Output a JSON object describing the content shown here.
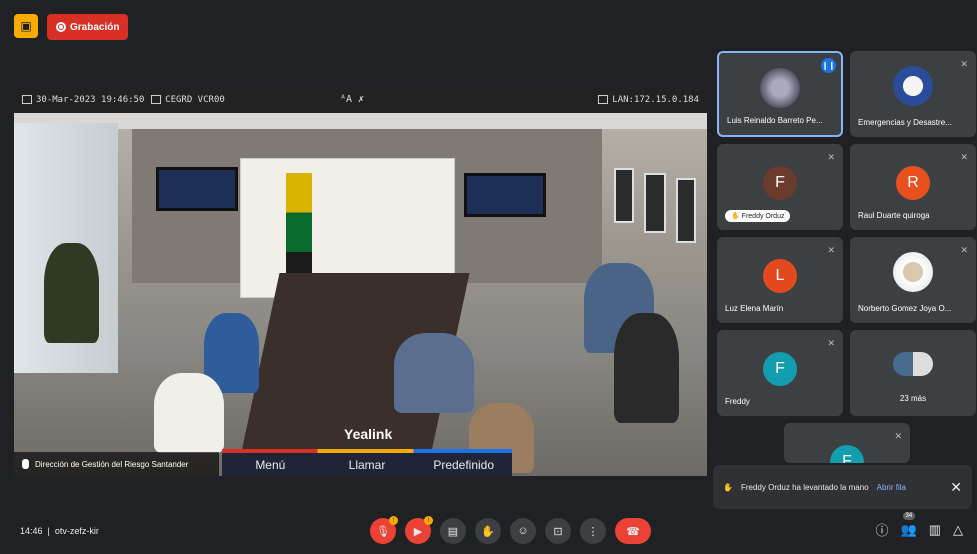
{
  "recording": {
    "label": "Grabación"
  },
  "main_video": {
    "date": "30-Mar-2023 19:46:50",
    "camera": "CEGRD VCR00",
    "lan": "LAN:172.15.0.184",
    "presenter": "Dirección de Gestión del Riesgo Santander",
    "brand": "Yealink",
    "menu": [
      "Menú",
      "Llamar",
      "Predefinido"
    ]
  },
  "participants": [
    {
      "name": "Luis Reinaldo Barreto Pe...",
      "speaking": true
    },
    {
      "name": "Emergencias y Desastre..."
    },
    {
      "name": "Freddy Orduz",
      "initial": "F",
      "color": "#6b3b2d",
      "hand": "Freddy Orduz"
    },
    {
      "name": "Raul Duarte quiroga",
      "initial": "R",
      "color": "#e8501e"
    },
    {
      "name": "Luz Elena Marín",
      "initial": "L",
      "color": "#e24a1d"
    },
    {
      "name": "Norberto Gomez Joya O..."
    },
    {
      "name": "Freddy",
      "initial": "F",
      "color": "#129eaf"
    },
    {
      "name": "23 más"
    },
    {
      "initial": "F",
      "color": "#129eaf"
    }
  ],
  "notification": {
    "text": "Freddy Orduz ha levantado la mano",
    "action": "Abrir fila"
  },
  "meeting": {
    "time": "14:46",
    "code": "otv-zefz-kir"
  },
  "people_count": "34"
}
